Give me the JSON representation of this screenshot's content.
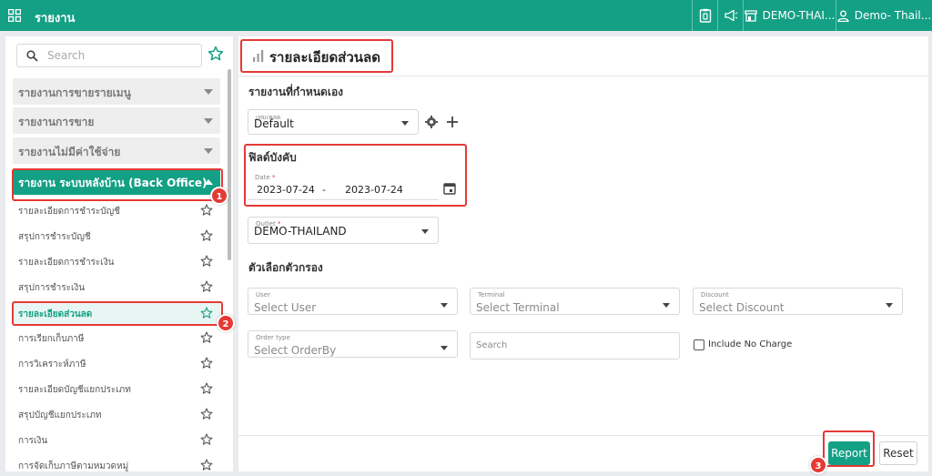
{
  "topbar": {
    "title": "รายงาน",
    "branch": "DEMO-THAI...",
    "user": "Demo- Thail...",
    "icons": [
      "grid-icon",
      "clipboard-phone-icon",
      "megaphone-icon",
      "store-icon",
      "user-icon"
    ]
  },
  "sidebar": {
    "search_placeholder": "Search",
    "groups": [
      {
        "label": "รายงานการขายรายเมนู"
      },
      {
        "label": "รายงานการขาย"
      },
      {
        "label": "รายงานไม่มีค่าใช้จ่าย"
      },
      {
        "label": "รายงาน ระบบหลังบ้าน (Back Office)"
      }
    ],
    "items": [
      {
        "label": "รายละเอียดการชำระบัญชี"
      },
      {
        "label": "สรุปการชำระบัญชี"
      },
      {
        "label": "รายละเอียดการชำระเงิน"
      },
      {
        "label": "สรุปการชำระเงิน"
      },
      {
        "label": "รายละเอียดส่วนลด"
      },
      {
        "label": "การเรียกเก็บภาษี"
      },
      {
        "label": "การวิเคราะห์ภาษี"
      },
      {
        "label": "รายละเอียดบัญชีแยกประเภท"
      },
      {
        "label": "สรุปบัญชีแยกประเภท"
      },
      {
        "label": "การเงิน"
      },
      {
        "label": "การจัดเก็บภาษีตามหมวดหมู่"
      }
    ]
  },
  "badges": {
    "b1": "1",
    "b2": "2",
    "b3": "3"
  },
  "main": {
    "title": "รายละเอียดส่วนลด",
    "custom_report": {
      "section_title": "รายงานที่กำหนดเอง",
      "template_label": "เทมเพลต",
      "template_value": "Default"
    },
    "required": {
      "section_title": "ฟิลด์บังคับ",
      "date_label": "Date",
      "date_start": "2023-07-24",
      "date_sep": "-",
      "date_end": "2023-07-24",
      "outlet_label": "Outlet",
      "outlet_value": "DEMO-THAILAND",
      "required_mark": "*"
    },
    "filters": {
      "section_title": "ตัวเลือกตัวกรอง",
      "user_label": "User",
      "user_placeholder": "Select User",
      "terminal_label": "Terminal",
      "terminal_placeholder": "Select Terminal",
      "discount_label": "Discount",
      "discount_placeholder": "Select Discount",
      "orderby_label": "Order type",
      "orderby_placeholder": "Select OrderBy",
      "search_placeholder": "Search",
      "include_no_charge": "Include No Charge"
    },
    "buttons": {
      "report": "Report",
      "reset": "Reset"
    }
  },
  "colors": {
    "accent": "#14a085",
    "highlight": "#e53935"
  }
}
